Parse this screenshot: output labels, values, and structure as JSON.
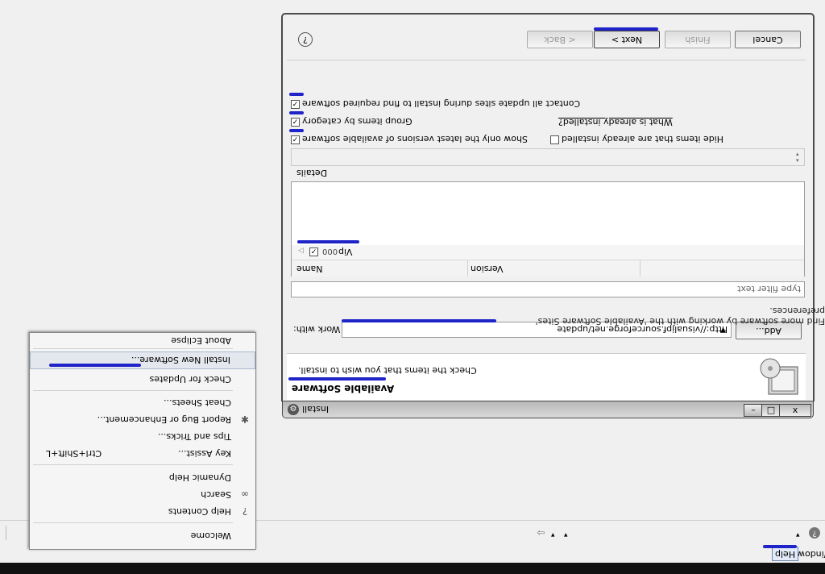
{
  "window": {
    "title": "Install",
    "controls": {
      "minimize": "–",
      "maximize": "□",
      "close": "x"
    },
    "header": {
      "title": "Available Software",
      "subtitle": "Check the items that you wish to install."
    },
    "work_with_label": "Work with:",
    "work_with_value": "http://visualjpf.sourceforge.net/update",
    "add_label": "Add...",
    "find_more_text": "Find more software by working with the 'Available Software Sites' preferences.",
    "filter_placeholder": "type filter text",
    "columns": {
      "name": "Name",
      "version": "Version"
    },
    "tree_item": "Vip",
    "tree_item_prefix": "000",
    "details_label": "Details",
    "options": {
      "show_latest": "Show only the latest versions of available software",
      "hide_installed": "Hide items that are already installed",
      "group_by_category": "Group items by category",
      "what_installed": "What is already installed?",
      "contact_sites": "Contact all update sites during install to find required software"
    },
    "buttons": {
      "back": "< Back",
      "next": "Next >",
      "finish": "Finish",
      "cancel": "Cancel"
    },
    "help_icon": "question-circle-icon"
  },
  "menubar": {
    "window": "Window",
    "help": "Help"
  },
  "help_menu": [
    {
      "label": "Welcome",
      "icon": "",
      "accel": ""
    },
    {
      "label": "Help Contents",
      "icon": "help-contents-icon",
      "accel": ""
    },
    {
      "label": "Search",
      "icon": "search-binoculars-icon",
      "accel": ""
    },
    {
      "label": "Dynamic Help",
      "icon": "",
      "accel": ""
    },
    {
      "label": "Key Assist...",
      "icon": "",
      "accel": "Ctrl+Shift+L"
    },
    {
      "label": "Tips and Tricks...",
      "icon": "",
      "accel": ""
    },
    {
      "label": "Report Bug or Enhancement...",
      "icon": "bug-icon",
      "accel": ""
    },
    {
      "label": "Cheat Sheets...",
      "icon": "",
      "accel": ""
    },
    {
      "label": "Check for Updates",
      "icon": "",
      "accel": ""
    },
    {
      "label": "Install New Software...",
      "icon": "",
      "accel": ""
    },
    {
      "label": "About Eclipse",
      "icon": "",
      "accel": ""
    }
  ],
  "colors": {
    "annotation_mark": "#1f24c8"
  }
}
